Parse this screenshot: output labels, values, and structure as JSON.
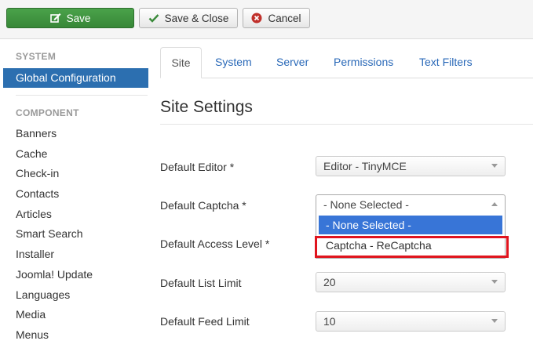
{
  "toolbar": {
    "save_label": "Save",
    "save_close_label": "Save & Close",
    "cancel_label": "Cancel"
  },
  "sidebar": {
    "system_heading": "SYSTEM",
    "active_item": "Global Configuration",
    "component_heading": "COMPONENT",
    "items": [
      "Banners",
      "Cache",
      "Check-in",
      "Contacts",
      "Articles",
      "Smart Search",
      "Installer",
      "Joomla! Update",
      "Languages",
      "Media",
      "Menus"
    ]
  },
  "tabs": [
    "Site",
    "System",
    "Server",
    "Permissions",
    "Text Filters"
  ],
  "main": {
    "title": "Site Settings",
    "fields": {
      "editor": {
        "label": "Default Editor *",
        "value": "Editor - TinyMCE"
      },
      "captcha": {
        "label": "Default Captcha *",
        "value": "- None Selected -",
        "options": [
          "- None Selected -",
          "Captcha - ReCaptcha"
        ]
      },
      "access": {
        "label": "Default Access Level *"
      },
      "list_limit": {
        "label": "Default List Limit",
        "value": "20"
      },
      "feed_limit": {
        "label": "Default Feed Limit",
        "value": "10"
      }
    }
  },
  "colors": {
    "save_button": "#46a046",
    "sidebar_active": "#2c6fb0",
    "tab_link": "#2a69b8",
    "option_selected": "#3875d7",
    "highlight_box": "#e0141e"
  }
}
